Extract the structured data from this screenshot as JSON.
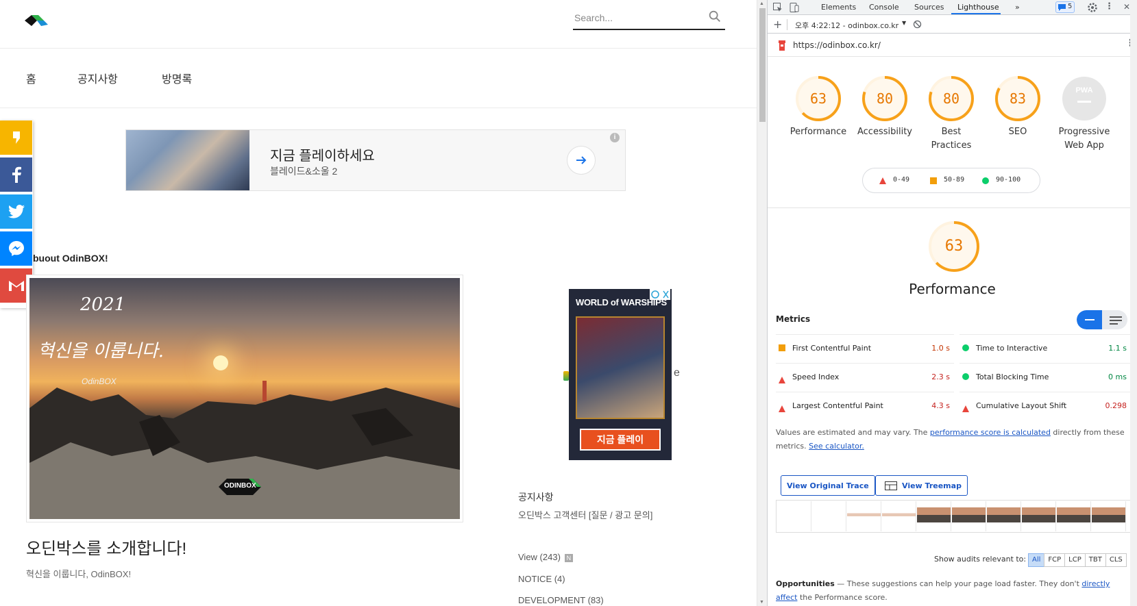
{
  "site": {
    "search_placeholder": "Search...",
    "nav": [
      "홈",
      "공지사항",
      "방명록"
    ],
    "ad_top": {
      "title": "지금 플레이하세요",
      "subtitle": "블레이드&소울 2"
    },
    "about": "buout OdinBOX!",
    "hero": {
      "year": "2021",
      "headline": "혁신을 이룹니다.",
      "brand": "OdinBOX",
      "watermark": "ODINBOX"
    },
    "post_title": "오딘박스를 소개합니다!",
    "post_sub": "혁신을 이룹니다, OdinBOX!",
    "ad_side": {
      "brand": "WORLD of WARSHIPS",
      "cta": "지금 플레이"
    },
    "ghost_letter": "e",
    "sidebar": {
      "heading": "공지사항",
      "link": "오딘박스 고객센터 [질문 / 광고 문의]",
      "categories": [
        {
          "label": "View (243)",
          "badge": "N"
        },
        {
          "label": "NOTICE (4)"
        },
        {
          "label": "DEVELOPMENT (83)"
        }
      ]
    }
  },
  "devtools": {
    "tabs": [
      "Elements",
      "Console",
      "Sources",
      "Lighthouse",
      "»"
    ],
    "active_tab": "Lighthouse",
    "issues_count": "5",
    "report_select": "오후 4:22:12 - odinbox.co.kr",
    "url": "https://odinbox.co.kr/",
    "scores": [
      {
        "value": "63",
        "label": "Performance"
      },
      {
        "value": "80",
        "label": "Accessibility"
      },
      {
        "value": "80",
        "label": "Best Practices"
      },
      {
        "value": "83",
        "label": "SEO"
      },
      {
        "value": "PWA",
        "label": "Progressive Web App"
      }
    ],
    "legend": [
      "0-49",
      "50-89",
      "90-100"
    ],
    "perf_score": "63",
    "perf_title": "Performance",
    "metrics_heading": "Metrics",
    "metrics": [
      {
        "label": "First Contentful Paint",
        "value": "1.0 s",
        "status": "average"
      },
      {
        "label": "Time to Interactive",
        "value": "1.1 s",
        "status": "pass"
      },
      {
        "label": "Speed Index",
        "value": "2.3 s",
        "status": "fail"
      },
      {
        "label": "Total Blocking Time",
        "value": "0 ms",
        "status": "pass"
      },
      {
        "label": "Largest Contentful Paint",
        "value": "4.3 s",
        "status": "fail"
      },
      {
        "label": "Cumulative Layout Shift",
        "value": "0.298",
        "status": "fail"
      }
    ],
    "note": {
      "pre": "Values are estimated and may vary. The ",
      "link1": "performance score is calculated",
      "mid": " directly from these metrics. ",
      "link2": "See calculator."
    },
    "buttons": {
      "trace": "View Original Trace",
      "treemap": "View Treemap"
    },
    "audits_label": "Show audits relevant to:",
    "audit_chips": [
      "All",
      "FCP",
      "LCP",
      "TBT",
      "CLS"
    ],
    "opportunities": {
      "title": "Opportunities",
      "text": " — These suggestions can help your page load faster. They don't ",
      "link": "directly affect",
      "tail": " the Performance score."
    },
    "colors": {
      "fail": "#e8453c",
      "average": "#f29e0b",
      "pass": "#0cce6b",
      "gauge": "#f7a11a",
      "value_fail": "#c5221f",
      "value_avg": "#c33300",
      "value_pass": "#018642"
    }
  }
}
